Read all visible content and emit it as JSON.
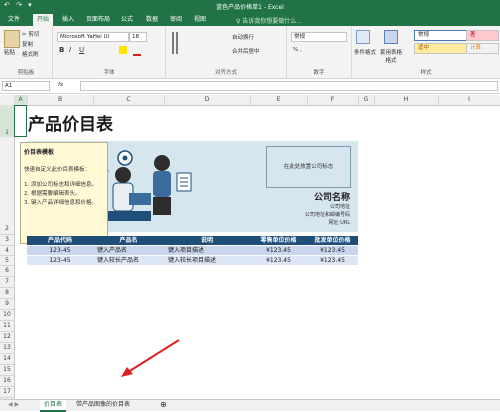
{
  "title_bar": {
    "quick_access": "↶ ↷ ▾",
    "title": "蓝色产品价格单1 - Excel"
  },
  "tabs": [
    "文件",
    "开始",
    "插入",
    "页面布局",
    "公式",
    "数据",
    "审阅",
    "视图"
  ],
  "tell_me": "♀ 告诉我你想要做什么...",
  "ribbon": {
    "clipboard": {
      "paste": "粘贴",
      "cut": "✂ 剪切",
      "copy": "复制",
      "format_painter": "格式刷",
      "label": "剪贴板"
    },
    "font": {
      "family": "Microsoft YaHei UI",
      "size": "18",
      "bold": "B",
      "italic": "I",
      "underline": "U",
      "label": "字体"
    },
    "alignment": {
      "wrap": "自动换行",
      "merge": "合并后居中",
      "label": "对齐方式"
    },
    "number": {
      "format": "常规",
      "percent": "% ,",
      "label": "数字"
    },
    "styles": {
      "conditional": "条件格式",
      "table_format": "套用表格格式",
      "normal": "常规",
      "bad": "差",
      "neutral": "适中",
      "calc": "计算",
      "label": "样式"
    }
  },
  "formula_bar": {
    "name_box": "A1",
    "fx": "fx"
  },
  "columns": [
    "A",
    "B",
    "C",
    "D",
    "E",
    "F",
    "G",
    "H",
    "I"
  ],
  "rows": [
    "1",
    "2",
    "3",
    "4",
    "5",
    "6",
    "7",
    "8",
    "9",
    "10",
    "11",
    "12",
    "13",
    "14",
    "15",
    "16",
    "17"
  ],
  "sheet": {
    "title": "产品价目表",
    "logo_placeholder": "在此处放置公司标志",
    "company_name": "公司名称",
    "address_lines": [
      "公司地址",
      "公司地址和邮编号码",
      "网址 URL"
    ],
    "tooltip": {
      "title": "价目表模板",
      "lines": [
        "快速自定义此价目表模板：",
        "1. 添加公司标志和详细信息。",
        "2. 根据需要编辑表头。",
        "3. 键入产品详细信息和价格。"
      ]
    },
    "table": {
      "headers": [
        "产品代码",
        "产品名",
        "说明",
        "零售单位价格",
        "批发单位价格"
      ],
      "rows": [
        [
          "123-45",
          "键入产品名",
          "键入项目描述",
          "¥123.45",
          "¥123.45"
        ],
        [
          "123-45",
          "键入较长产品名",
          "键入较长项目描述",
          "¥123.45",
          "¥123.45"
        ]
      ]
    }
  },
  "sheet_tabs": [
    "价目表",
    "带产品图像的价目表"
  ],
  "colors": {
    "excel_green": "#217346",
    "table_header": "#1f4e79",
    "banner": "#d6e6ef"
  }
}
